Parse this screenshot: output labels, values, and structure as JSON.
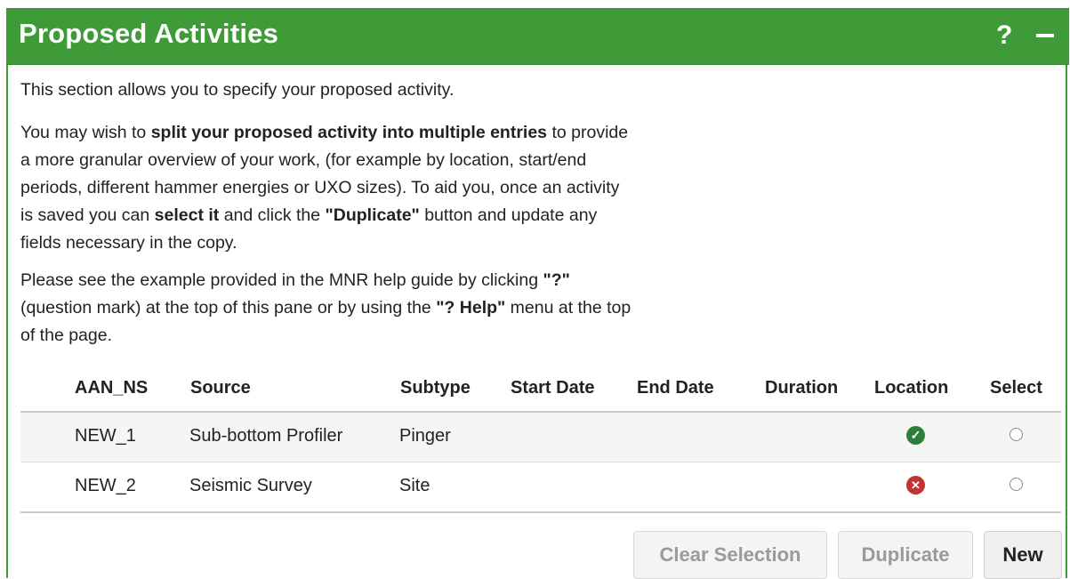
{
  "header": {
    "title": "Proposed Activities",
    "help_label": "?",
    "collapse_label": "–"
  },
  "intro": {
    "p1": "This section allows you to specify your proposed activity.",
    "p2": {
      "a": "You may wish to ",
      "b": "split your proposed activity into multiple entries",
      "c": " to provide",
      "d": "a more granular overview of your work, (for example by location, start/end",
      "e": "periods, different hammer energies or UXO sizes). To aid you, once an activity",
      "f": "is saved you can ",
      "g": "select it",
      "h": " and click the ",
      "i": "\"Duplicate\"",
      "j": " button and update any",
      "k": "fields necessary in the copy."
    },
    "p3": {
      "a": "Please see the example provided in the MNR help guide by clicking ",
      "b": "\"?\"",
      "c": "(question mark) at the top of this pane or by using the ",
      "d": "\"? Help\"",
      "e": " menu at the top",
      "f": "of the page."
    }
  },
  "table": {
    "columns": [
      "AAN_NS",
      "Source",
      "Subtype",
      "Start Date",
      "End Date",
      "Duration",
      "Location",
      "Select"
    ],
    "rows": [
      {
        "aan_ns": "NEW_1",
        "source": "Sub-bottom Profiler",
        "subtype": "Pinger",
        "start_date": "",
        "end_date": "",
        "duration": "",
        "location_status": "valid",
        "selected": false
      },
      {
        "aan_ns": "NEW_2",
        "source": "Seismic Survey",
        "subtype": "Site",
        "start_date": "",
        "end_date": "",
        "duration": "",
        "location_status": "invalid",
        "selected": false
      }
    ]
  },
  "buttons": {
    "clear_selection": "Clear Selection",
    "duplicate": "Duplicate",
    "new": "New"
  },
  "icons": {
    "location_valid": "check-circle-icon",
    "location_invalid": "x-circle-icon"
  },
  "colors": {
    "header_bg": "#3f9b37",
    "valid": "#2f7d3a",
    "invalid": "#c13434"
  }
}
